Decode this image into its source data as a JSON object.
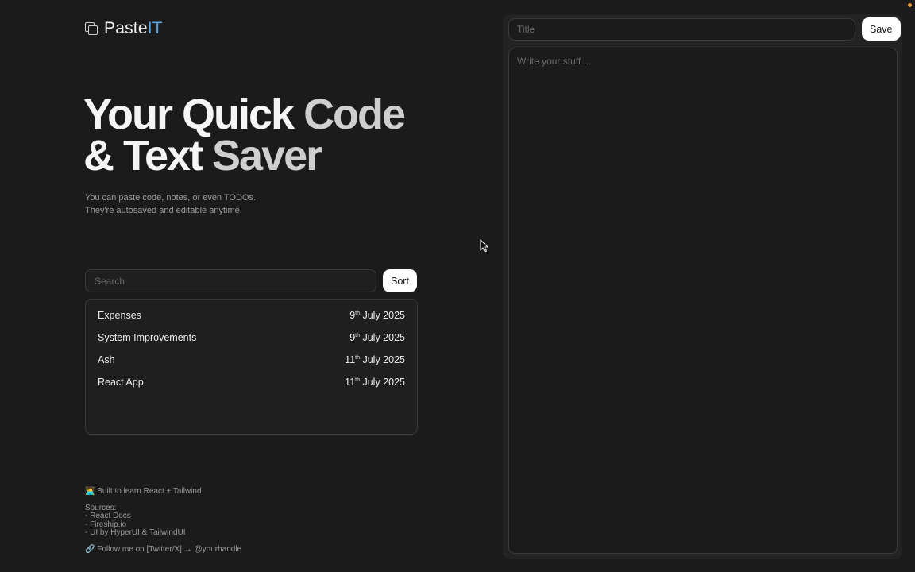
{
  "app": {
    "name_part1": "Paste",
    "name_part2": "IT"
  },
  "hero": {
    "line1_strong": "Your Quick ",
    "line1_dim": "Code",
    "line2_strong": "& Text ",
    "line2_dim": "Saver",
    "subtitle_line1": "You can paste code, notes, or even TODOs.",
    "subtitle_line2": "They're autosaved and editable anytime."
  },
  "search": {
    "placeholder": "Search",
    "value": "",
    "sort_label": "Sort"
  },
  "pastes": [
    {
      "title": "Expenses",
      "day": "9",
      "suffix": "th",
      "rest": "July 2025"
    },
    {
      "title": "System Improvements",
      "day": "9",
      "suffix": "th",
      "rest": "July 2025"
    },
    {
      "title": "Ash",
      "day": "11",
      "suffix": "th",
      "rest": "July 2025"
    },
    {
      "title": "React App",
      "day": "11",
      "suffix": "th",
      "rest": "July 2025"
    }
  ],
  "footer": {
    "built": "🧑‍💻 Built to learn React + Tailwind",
    "sources_heading": "Sources:",
    "sources": [
      "- React Docs",
      "- Fireship.io",
      "- UI by HyperUI & TailwindUI"
    ],
    "follow": "🔗 Follow me on [Twitter/X] → @yourhandle"
  },
  "editor": {
    "title_placeholder": "Title",
    "title_value": "",
    "save_label": "Save",
    "content_placeholder": "Write your stuff ...",
    "content_value": ""
  },
  "colors": {
    "background": "#1b1b1b",
    "accent": "#5aa7e6",
    "status_dot": "#e8953a"
  },
  "icons": {
    "logo": "copy-icon",
    "cursor": "mouse-pointer-icon"
  }
}
